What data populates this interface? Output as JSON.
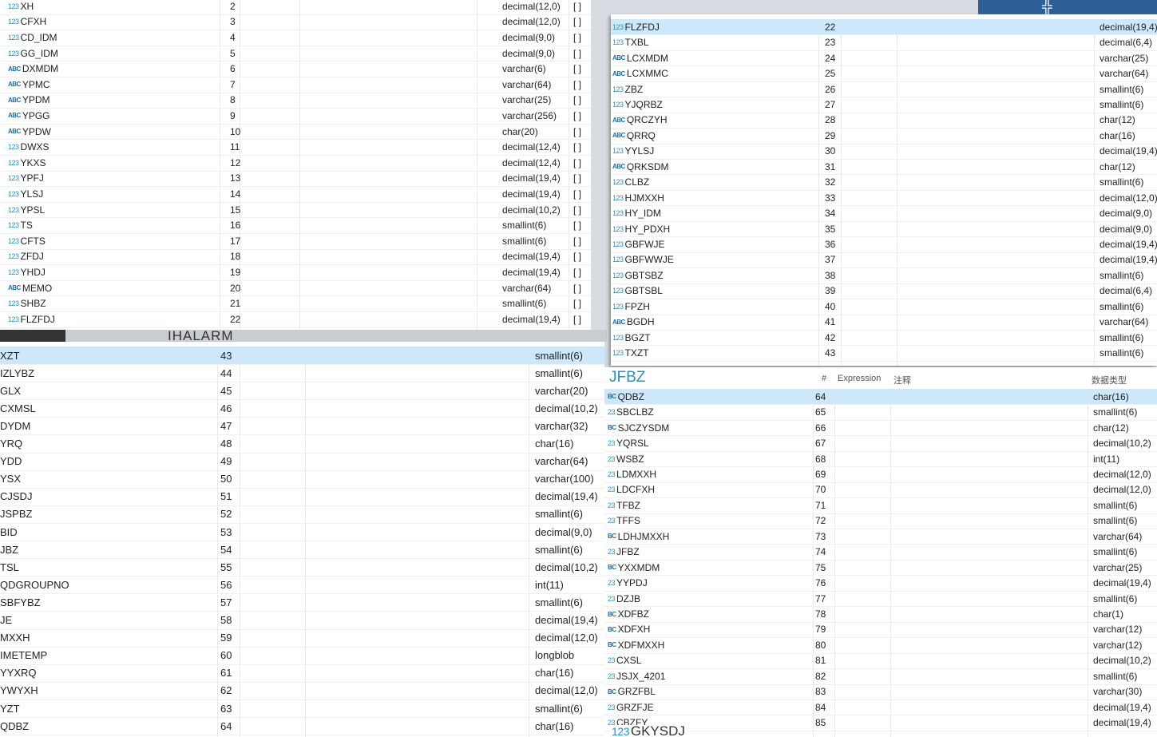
{
  "background": {
    "folder_label": "IHALARM",
    "bottom_label": "GKYSDJ",
    "top_right_label": "JFBZ"
  },
  "panel_d_header": {
    "col_hash": "#",
    "col_expression": "Expression",
    "col_comment": "注释",
    "col_type": "数据类型"
  },
  "panel_a": [
    [
      "123",
      "XH",
      "2",
      "decimal(12,0)"
    ],
    [
      "123",
      "CFXH",
      "3",
      "decimal(12,0)"
    ],
    [
      "123",
      "CD_IDM",
      "4",
      "decimal(9,0)"
    ],
    [
      "123",
      "GG_IDM",
      "5",
      "decimal(9,0)"
    ],
    [
      "ABC",
      "DXMDM",
      "6",
      "varchar(6)"
    ],
    [
      "ABC",
      "YPMC",
      "7",
      "varchar(64)"
    ],
    [
      "ABC",
      "YPDM",
      "8",
      "varchar(25)"
    ],
    [
      "ABC",
      "YPGG",
      "9",
      "varchar(256)"
    ],
    [
      "ABC",
      "YPDW",
      "10",
      "char(20)"
    ],
    [
      "123",
      "DWXS",
      "11",
      "decimal(12,4)"
    ],
    [
      "123",
      "YKXS",
      "12",
      "decimal(12,4)"
    ],
    [
      "123",
      "YPFJ",
      "13",
      "decimal(19,4)"
    ],
    [
      "123",
      "YLSJ",
      "14",
      "decimal(19,4)"
    ],
    [
      "123",
      "YPSL",
      "15",
      "decimal(10,2)"
    ],
    [
      "123",
      "TS",
      "16",
      "smallint(6)"
    ],
    [
      "123",
      "CFTS",
      "17",
      "smallint(6)"
    ],
    [
      "123",
      "ZFDJ",
      "18",
      "decimal(19,4)"
    ],
    [
      "123",
      "YHDJ",
      "19",
      "decimal(19,4)"
    ],
    [
      "ABC",
      "MEMO",
      "20",
      "varchar(64)"
    ],
    [
      "123",
      "SHBZ",
      "21",
      "smallint(6)"
    ],
    [
      "123",
      "FLZFDJ",
      "22",
      "decimal(19,4)"
    ]
  ],
  "panel_a_checkbox": "[ ]",
  "panel_b": [
    [
      "123",
      "FLZFDJ",
      "22",
      "decimal(19,4)"
    ],
    [
      "123",
      "TXBL",
      "23",
      "decimal(6,4)"
    ],
    [
      "ABC",
      "LCXMDM",
      "24",
      "varchar(25)"
    ],
    [
      "ABC",
      "LCXMMC",
      "25",
      "varchar(64)"
    ],
    [
      "123",
      "ZBZ",
      "26",
      "smallint(6)"
    ],
    [
      "123",
      "YJQRBZ",
      "27",
      "smallint(6)"
    ],
    [
      "ABC",
      "QRCZYH",
      "28",
      "char(12)"
    ],
    [
      "ABC",
      "QRRQ",
      "29",
      "char(16)"
    ],
    [
      "123",
      "YYLSJ",
      "30",
      "decimal(19,4)"
    ],
    [
      "ABC",
      "QRKSDM",
      "31",
      "char(12)"
    ],
    [
      "123",
      "CLBZ",
      "32",
      "smallint(6)"
    ],
    [
      "123",
      "HJMXXH",
      "33",
      "decimal(12,0)"
    ],
    [
      "123",
      "HY_IDM",
      "34",
      "decimal(9,0)"
    ],
    [
      "123",
      "HY_PDXH",
      "35",
      "decimal(9,0)"
    ],
    [
      "123",
      "GBFWJE",
      "36",
      "decimal(19,4)"
    ],
    [
      "123",
      "GBFWWJE",
      "37",
      "decimal(19,4)"
    ],
    [
      "123",
      "GBTSBZ",
      "38",
      "smallint(6)"
    ],
    [
      "123",
      "GBTSBL",
      "39",
      "decimal(6,4)"
    ],
    [
      "123",
      "FPZH",
      "40",
      "smallint(6)"
    ],
    [
      "ABC",
      "BGDH",
      "41",
      "varchar(64)"
    ],
    [
      "123",
      "BGZT",
      "42",
      "smallint(6)"
    ],
    [
      "123",
      "TXZT",
      "43",
      "smallint(6)"
    ]
  ],
  "panel_c": [
    [
      "",
      "XZT",
      "43",
      "smallint(6)"
    ],
    [
      "",
      "IZLYBZ",
      "44",
      "smallint(6)"
    ],
    [
      "",
      "GLX",
      "45",
      "varchar(20)"
    ],
    [
      "",
      "CXMSL",
      "46",
      "decimal(10,2)"
    ],
    [
      "",
      "DYDM",
      "47",
      "varchar(32)"
    ],
    [
      "",
      "YRQ",
      "48",
      "char(16)"
    ],
    [
      "",
      "YDD",
      "49",
      "varchar(64)"
    ],
    [
      "",
      "YSX",
      "50",
      "varchar(100)"
    ],
    [
      "",
      "CJSDJ",
      "51",
      "decimal(19,4)"
    ],
    [
      "",
      "JSPBZ",
      "52",
      "smallint(6)"
    ],
    [
      "",
      "BID",
      "53",
      "decimal(9,0)"
    ],
    [
      "",
      "JBZ",
      "54",
      "smallint(6)"
    ],
    [
      "",
      "TSL",
      "55",
      "decimal(10,2)"
    ],
    [
      "",
      "QDGROUPNO",
      "56",
      "int(11)"
    ],
    [
      "",
      "SBFYBZ",
      "57",
      "smallint(6)"
    ],
    [
      "",
      "JE",
      "58",
      "decimal(19,4)"
    ],
    [
      "",
      "MXXH",
      "59",
      "decimal(12,0)"
    ],
    [
      "",
      "IMETEMP",
      "60",
      "longblob"
    ],
    [
      "",
      "YYXRQ",
      "61",
      "char(16)"
    ],
    [
      "",
      "YWYXH",
      "62",
      "decimal(12,0)"
    ],
    [
      "",
      "YZT",
      "63",
      "smallint(6)"
    ],
    [
      "",
      "QDBZ",
      "64",
      "char(16)"
    ]
  ],
  "panel_d": [
    [
      "BC",
      "QDBZ",
      "64",
      "char(16)"
    ],
    [
      "23",
      "SBCLBZ",
      "65",
      "smallint(6)"
    ],
    [
      "BC",
      "SJCZYSDM",
      "66",
      "char(12)"
    ],
    [
      "23",
      "YQRSL",
      "67",
      "decimal(10,2)"
    ],
    [
      "23",
      "WSBZ",
      "68",
      "int(11)"
    ],
    [
      "23",
      "LDMXXH",
      "69",
      "decimal(12,0)"
    ],
    [
      "23",
      "LDCFXH",
      "70",
      "decimal(12,0)"
    ],
    [
      "23",
      "TFBZ",
      "71",
      "smallint(6)"
    ],
    [
      "23",
      "TFFS",
      "72",
      "smallint(6)"
    ],
    [
      "BC",
      "LDHJMXXH",
      "73",
      "varchar(64)"
    ],
    [
      "23",
      "JFBZ",
      "74",
      "smallint(6)"
    ],
    [
      "BC",
      "YXXMDM",
      "75",
      "varchar(25)"
    ],
    [
      "23",
      "YYPDJ",
      "76",
      "decimal(19,4)"
    ],
    [
      "23",
      "DZJB",
      "77",
      "smallint(6)"
    ],
    [
      "BC",
      "XDFBZ",
      "78",
      "char(1)"
    ],
    [
      "BC",
      "XDFXH",
      "79",
      "varchar(12)"
    ],
    [
      "BC",
      "XDFMXXH",
      "80",
      "varchar(12)"
    ],
    [
      "23",
      "CXSL",
      "81",
      "decimal(10,2)"
    ],
    [
      "23",
      "JSJX_4201",
      "82",
      "smallint(6)"
    ],
    [
      "BC",
      "GRZFBL",
      "83",
      "varchar(30)"
    ],
    [
      "23",
      "GRZFJE",
      "84",
      "decimal(19,4)"
    ],
    [
      "23",
      "CBZFY",
      "85",
      "decimal(19,4)"
    ]
  ]
}
